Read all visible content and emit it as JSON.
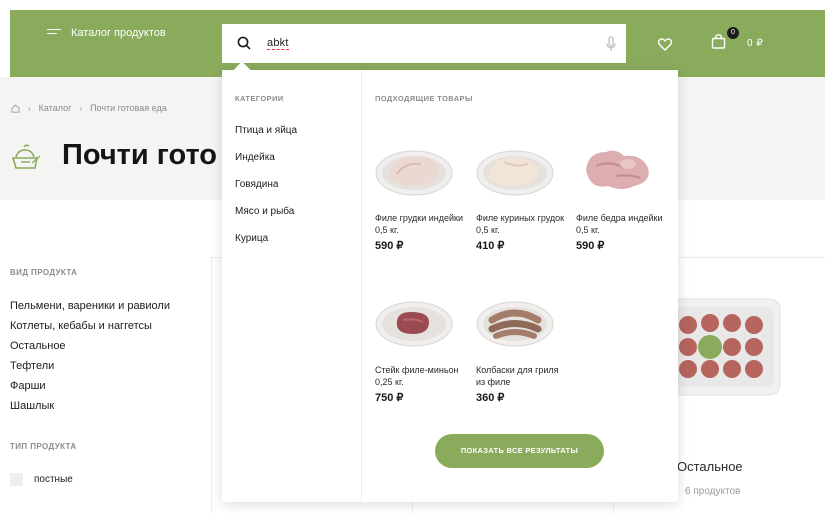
{
  "header": {
    "catalog_label": "Каталог продуктов",
    "search": {
      "value": "abkt"
    },
    "cart": {
      "count": "0",
      "total": "0 ₽"
    },
    "accent_color": "#8aab5c"
  },
  "breadcrumb": {
    "items": [
      "Каталог",
      "Почти готовая еда"
    ]
  },
  "page": {
    "title": "Почти гото"
  },
  "filters": {
    "product_kind_heading": "ВИД ПРОДУКТА",
    "product_kind_items": [
      "Пельмени, вареники и равиоли",
      "Котлеты, кебабы и наггетсы",
      "Остальное",
      "Тефтели",
      "Фарши",
      "Шашлык"
    ],
    "product_type_heading": "ТИП ПРОДУКТА",
    "product_type_items": [
      "постные"
    ]
  },
  "search_dropdown": {
    "categories_heading": "КАТЕГОРИИ",
    "categories": [
      "Птица и яйца",
      "Индейка",
      "Говядина",
      "Мясо и рыба",
      "Курица"
    ],
    "products_heading": "ПОДХОДЯЩИЕ ТОВАРЫ",
    "products": [
      {
        "name": "Филе грудки индейки 0,5 кг.",
        "price": "590 ₽",
        "icon": "turkey-fillet-image"
      },
      {
        "name": "Филе куриных грудок 0,5 кг.",
        "price": "410 ₽",
        "icon": "chicken-breast-image"
      },
      {
        "name": "Филе бедра индейки 0,5 кг.",
        "price": "590 ₽",
        "icon": "turkey-thigh-image"
      },
      {
        "name": "Стейк филе-миньон 0,25 кг.",
        "price": "750 ₽",
        "icon": "filet-mignon-image"
      },
      {
        "name": "Колбаски для гриля из филе",
        "price": "360 ₽",
        "icon": "grill-sausages-image"
      }
    ],
    "show_all_label": "ПОКАЗАТЬ ВСЕ РЕЗУЛЬТАТЫ"
  },
  "background_card": {
    "title": "Остальное",
    "count": "6 продуктов"
  }
}
